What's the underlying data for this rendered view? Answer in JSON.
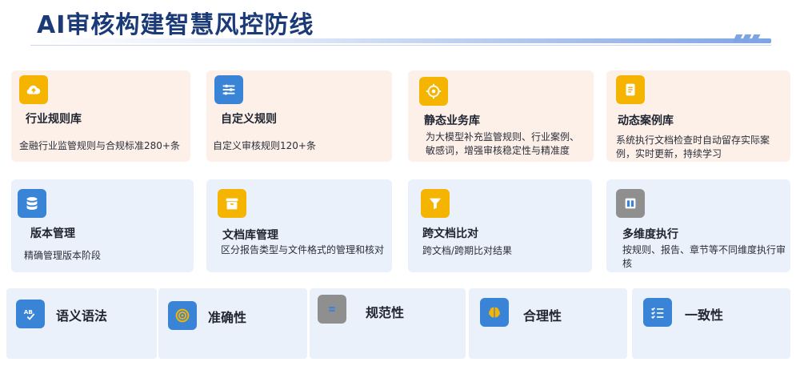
{
  "header": {
    "title": "AI审核构建智慧风控防线"
  },
  "row1": [
    {
      "title": "行业规则库",
      "desc": "金融行业监管规则与合规标准280+条",
      "icon": "cloud-upload-icon"
    },
    {
      "title": "自定义规则",
      "desc": "自定义审核规则120+条",
      "icon": "sliders-icon"
    },
    {
      "title": "静态业务库",
      "desc": "为大模型补充监管规则、行业案例、敏感词，增强审核稳定性与精准度",
      "icon": "target-icon"
    },
    {
      "title": "动态案例库",
      "desc": "系统执行文档检查时自动留存实际案例，实时更新，持续学习",
      "icon": "scroll-icon"
    }
  ],
  "row2": [
    {
      "title": "版本管理",
      "desc": "精确管理版本阶段",
      "icon": "database-icon"
    },
    {
      "title": "文档库管理",
      "desc": "区分报告类型与文件格式的管理和核对",
      "icon": "archive-icon"
    },
    {
      "title": "跨文档比对",
      "desc": "跨文档/跨期比对结果",
      "icon": "filter-icon"
    },
    {
      "title": "多维度执行",
      "desc": "按规则、报告、章节等不同维度执行审核",
      "icon": "columns-icon"
    }
  ],
  "row3": [
    {
      "title": "语义语法",
      "icon": "spellcheck-icon"
    },
    {
      "title": "准确性",
      "icon": "bullseye-icon"
    },
    {
      "title": "规范性",
      "icon": "equals-icon"
    },
    {
      "title": "合理性",
      "icon": "brain-icon"
    },
    {
      "title": "一致性",
      "icon": "checklist-icon"
    }
  ]
}
